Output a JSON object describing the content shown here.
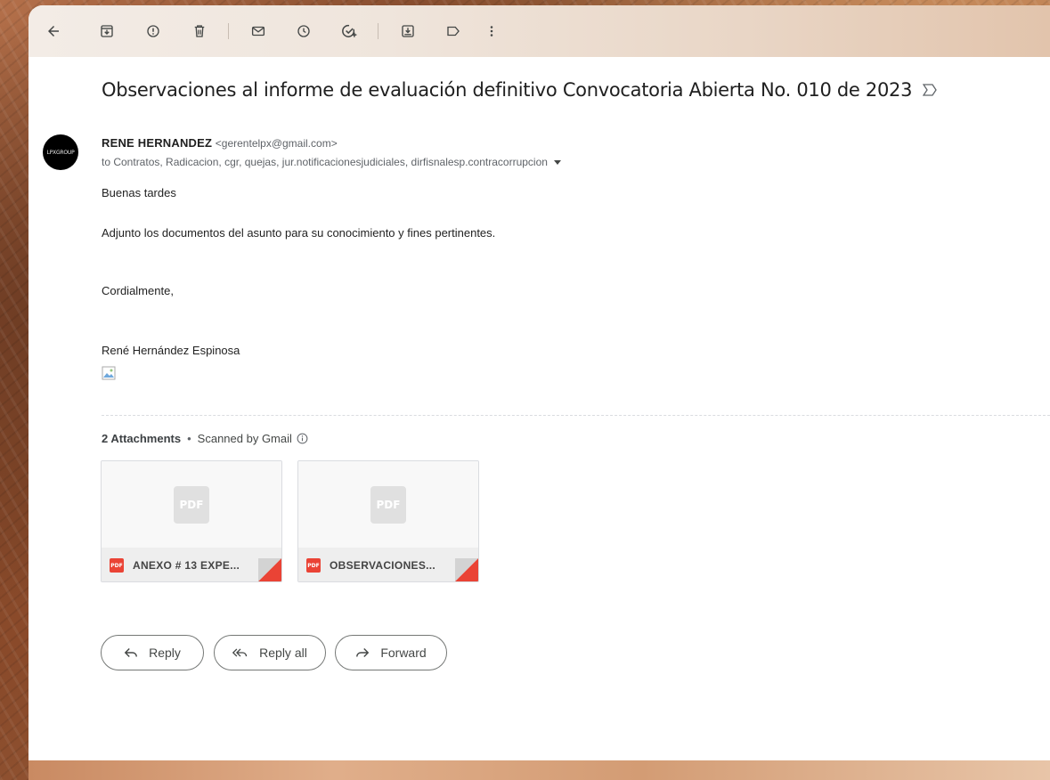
{
  "toolbar": {
    "back_icon": "arrow-left-icon",
    "archive_icon": "archive-icon",
    "report_spam_icon": "report-spam-icon",
    "delete_icon": "trash-icon",
    "mark_unread_icon": "mail-icon",
    "snooze_icon": "clock-icon",
    "add_task_icon": "add-task-icon",
    "move_to_icon": "move-to-icon",
    "label_icon": "label-icon",
    "more_icon": "more-vertical-icon"
  },
  "email": {
    "subject": "Observaciones al informe de evaluación definitivo Convocatoria Abierta No. 010 de 2023",
    "sender": {
      "name": "RENE HERNANDEZ",
      "email": "<gerentelpx@gmail.com>",
      "avatar_text": "LPXGROUP"
    },
    "recipients": "to Contratos, Radicacion, cgr, quejas, jur.notificacionesjudiciales, dirfisnalesp.contracorrupcion",
    "body": {
      "greeting": "Buenas tardes",
      "line1": "Adjunto los documentos del asunto para su conocimiento y fines pertinentes.",
      "closing": "Cordialmente,",
      "signature": "René Hernández Espinosa"
    }
  },
  "attachments": {
    "count_label": "2 Attachments",
    "scanned_label": "Scanned by Gmail",
    "thumb_label": "PDF",
    "badge_label": "PDF",
    "items": [
      {
        "name": "ANEXO # 13 EXPE..."
      },
      {
        "name": "OBSERVACIONES..."
      }
    ]
  },
  "actions": {
    "reply": "Reply",
    "reply_all": "Reply all",
    "forward": "Forward"
  },
  "colors": {
    "accent_pdf": "#ea4335",
    "text_primary": "#1f1f1f",
    "text_secondary": "#5f6368"
  }
}
